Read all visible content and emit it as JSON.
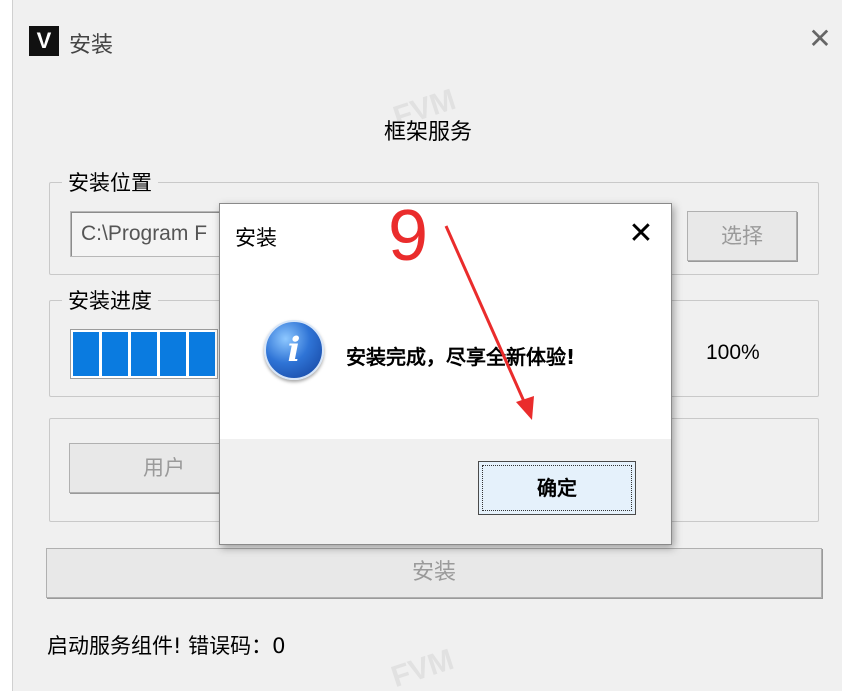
{
  "window": {
    "icon_letter": "V",
    "title": "安装",
    "close_glyph": "✕"
  },
  "heading": "框架服务",
  "install_location": {
    "label": "安装位置",
    "path_value": "C:\\Program F",
    "choose_button": "选择"
  },
  "install_progress": {
    "label": "安装进度",
    "percent_text": "100%",
    "progress_fraction": 1.0
  },
  "options": {
    "user_button": "用户"
  },
  "install_button": "安装",
  "status_text": "启动服务组件! 错误码：0",
  "watermark": "FVM",
  "dialog": {
    "title": "安装",
    "close_glyph": "✕",
    "icon": "info-icon",
    "message": "安装完成，尽享全新体验!",
    "ok_button": "确定"
  },
  "annotation": {
    "number": "9",
    "color": "#ea2c2c"
  },
  "colors": {
    "progress_fill": "#0a7be0",
    "window_bg": "#f0f0f0"
  }
}
